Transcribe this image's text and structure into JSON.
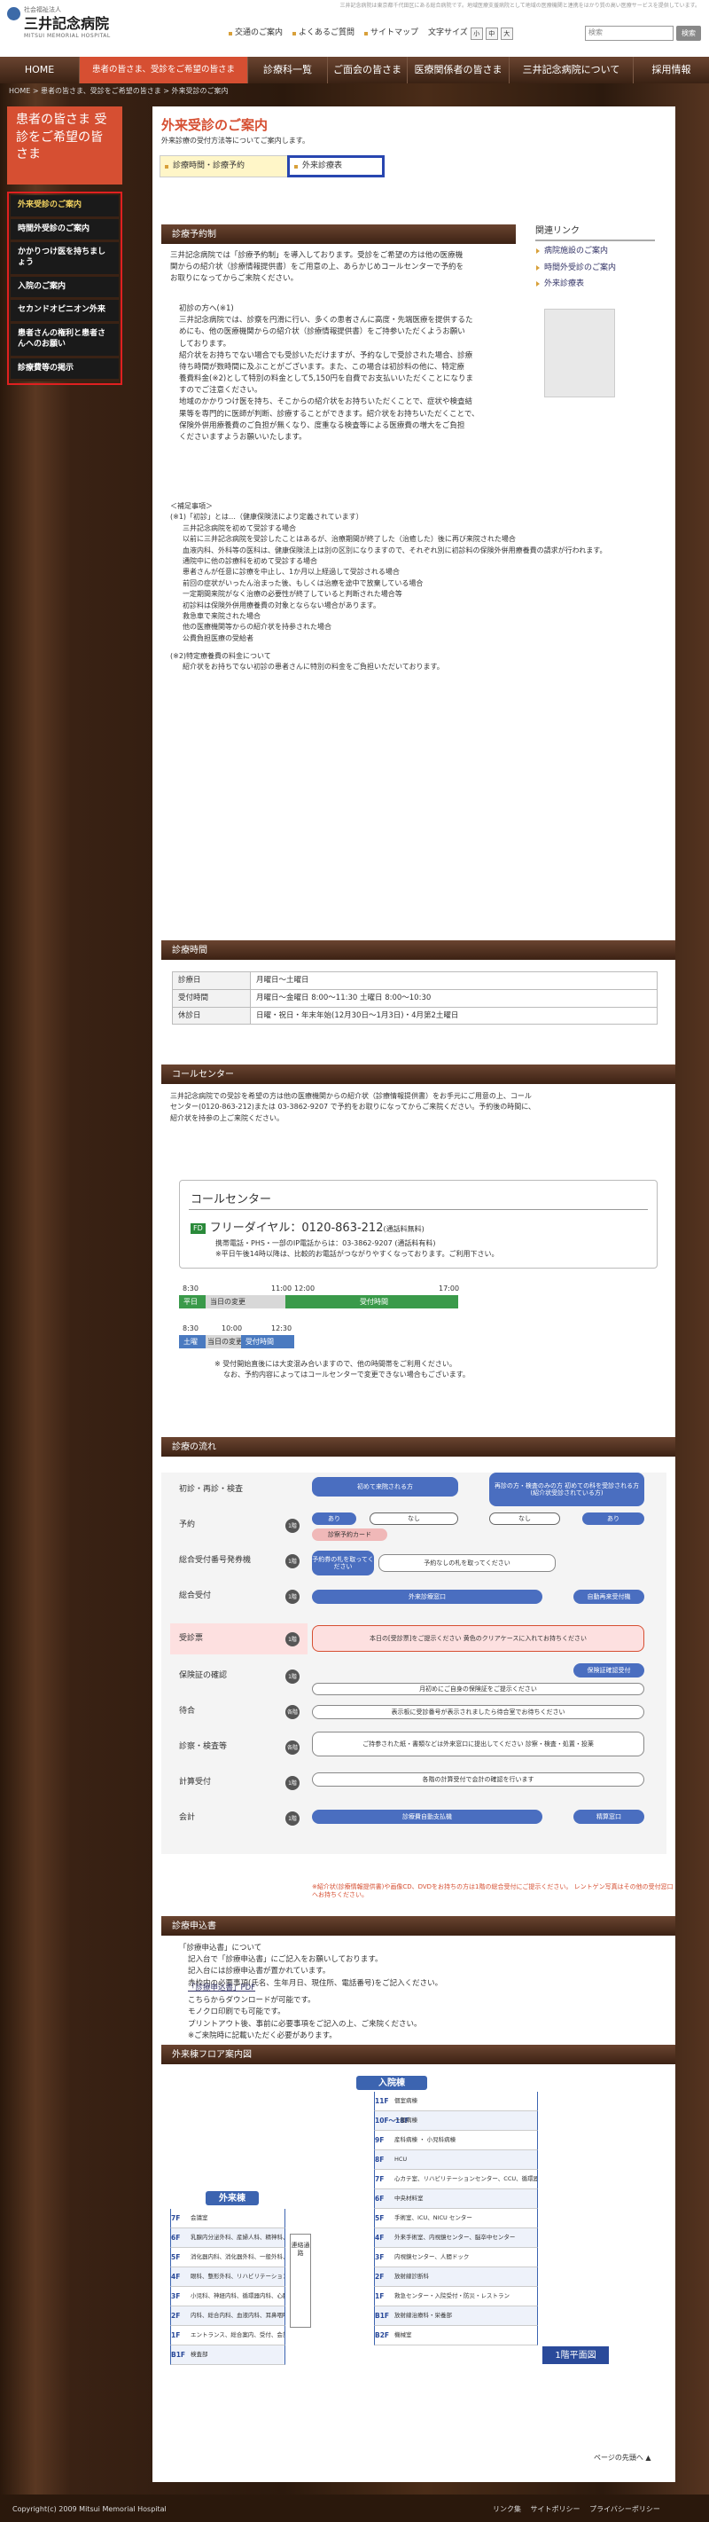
{
  "site": {
    "subtitle": "社会福祉法人",
    "name": "三井記念病院",
    "name_en": "MITSUI MEMORIAL HOSPITAL",
    "tagline": "三井記念病院は東京都千代田区にある総合病院です。地域医療支援病院として地域の医療機関と連携をはかり質の高い医療サービスを提供しています。"
  },
  "util": {
    "links": [
      "交通のご案内",
      "よくあるご質問",
      "サイトマップ"
    ],
    "font_size_label": "文字サイズ",
    "font_sizes": [
      "小",
      "中",
      "大"
    ],
    "search_placeholder": "検索",
    "search_button": "検索"
  },
  "gnav": [
    "HOME",
    "患者の皆さま、受診をご希望の皆さま",
    "診療科一覧",
    "ご面会の皆さま",
    "医療関係者の皆さま",
    "三井記念病院について",
    "採用情報"
  ],
  "breadcrumb": "HOME > 患者の皆さま、受診をご希望の皆さま > 外来受診のご案内",
  "sidebar": {
    "title": "患者の皆さま 受診をご希望の皆さま",
    "items": [
      "外来受診のご案内",
      "時間外受診のご案内",
      "かかりつけ医を持ちましょう",
      "入院のご案内",
      "セカンドオピニオン外来",
      "患者さんの権利と患者さんへのお願い",
      "診療費等の掲示"
    ]
  },
  "page": {
    "title": "外来受診のご案内",
    "lead": "外来診療の受付方法等についてご案内します。",
    "tabs": [
      "診療時間・診療予約",
      "外来診療表"
    ]
  },
  "related": {
    "title": "関連リンク",
    "items": [
      "病院施設のご案内",
      "時間外受診のご案内",
      "外来診療表"
    ]
  },
  "reservation": {
    "heading": "診療予約制",
    "p1": [
      "三井記念病院では「診療予約制」を導入しております。受診をご希望の方は他の医療機",
      "関からの紹介状（診療情報提供書）をご用意の上、あらかじめコールセンターで予約を",
      "お取りになってからご来院ください。"
    ],
    "note_title": "初診の方へ(※1)",
    "note": [
      "三井記念病院では、診察を円滑に行い、多くの患者さんに高度・先端医療を提供するた",
      "めにも、他の医療機関からの紹介状（診療情報提供書）をご持参いただくようお願い",
      "しております。",
      "紹介状をお持ちでない場合でも受診いただけますが、予約なしで受診された場合、診療",
      "待ち時間が数時間に及ぶことがございます。また、この場合は初診料の他に、特定療",
      "養費料金(※2)として特別の料金として5,150円を自費でお支払いいただくことになりま",
      "すのでご注意ください。",
      "地域のかかりつけ医を持ち、そこからの紹介状をお持ちいただくことで、症状や検査結",
      "果等を専門的に医師が判断、診療することができます。紹介状をお持ちいただくことで、",
      "保険外併用療養費のご負担が無くなり、度重なる検査等による医療費の増大をご負担",
      "くださいますようお願いいたします。"
    ],
    "supp_title": "＜補足事項＞",
    "supp": [
      "(※1)「初診」とは…（健康保険法により定義されています）",
      "三井記念病院を初めて受診する場合",
      "以前に三井記念病院を受診したことはあるが、治療期間が終了した（治癒した）後に再び来院された場合",
      "血液内科、外科等の医科は、健康保険法上は別の区別になりますので、それぞれ別に初診料の保険外併用療養費の請求が行われます。",
      "通院中に他の診療科を初めて受診する場合",
      "患者さんが任意に診療を中止し、1か月以上経過して受診される場合",
      "前回の症状がいったん治まった後、もしくは治療を途中で放棄している場合",
      "一定期間来院がなく治療の必要性が終了していると判断された場合等",
      "初診料は保険外併用療養費の対象とならない場合があります。",
      "救急車で来院された場合",
      "他の医療機関等からの紹介状を持参された場合",
      "公費負担医療の受給者",
      "(※2)特定療養費の料金について",
      "紹介状をお持ちでない初診の患者さんに特別の料金をご負担いただいております。"
    ]
  },
  "hours": {
    "heading": "診療時間",
    "rows": [
      {
        "label": "診療日",
        "value": "月曜日～土曜日"
      },
      {
        "label": "受付時間",
        "value": "月曜日～金曜日 8:00～11:30 土曜日 8:00～10:30"
      },
      {
        "label": "休診日",
        "value": "日曜・祝日・年末年始(12月30日～1月3日)・4月第2土曜日"
      }
    ]
  },
  "callcenter": {
    "heading": "コールセンター",
    "p": [
      "三井記念病院での受診を希望の方は他の医療機関からの紹介状（診療情報提供書）をお手元にご用意の上、コール",
      "センター(0120-863-212)または 03-3862-9207 で予約をお取りになってからご来院ください。予約後の時間に、",
      "紹介状を持参の上ご来院ください。"
    ],
    "box_title": "コールセンター",
    "free_label": "フリーダイヤル：0120-863-212",
    "free_note": "(通話料無料)",
    "note1": "携帯電話・PHS・一部のIP電話からは：03-3862-9207 (通話料有料)",
    "note2": "※平日午後14時以降は、比較的お電話がつながりやすくなっております。ご利用下さい。",
    "timeline": {
      "times_weekday": [
        "8:30",
        "11:00",
        "12:00",
        "17:00"
      ],
      "weekday_label": "平日",
      "weekday_seg1": "当日の変更",
      "weekday_seg2": "受付時間",
      "times_sat": [
        "8:30",
        "10:00",
        "12:30"
      ],
      "sat_label": "土曜",
      "sat_seg1": "当日の変更",
      "sat_seg2": "受付時間"
    },
    "notes": [
      "※ 受付開始直後には大変混み合いますので、他の時間帯をご利用ください。",
      "なお、予約内容によってはコールセンターで変更できない場合もございます。"
    ]
  },
  "flow": {
    "heading": "診療の流れ",
    "steps": [
      "初診・再診・検査",
      "予約",
      "総合受付番号発券機",
      "総合受付",
      "受診票",
      "保険証の確認",
      "待合",
      "診察・検査等",
      "計算受付",
      "会計"
    ],
    "nums": [
      "1階",
      "1階",
      "1階",
      "1階",
      "1階",
      "各階",
      "各階",
      "1階",
      "1階"
    ],
    "boxes": {
      "first": "初めて来院される方",
      "return": "再診の方・検査のみの方 初めての科を受診される方 (紹介状受診されている方)",
      "yes": "あり",
      "no": "なし",
      "reserve_card": "診察予約カード",
      "ticket": "予約券の札を取ってください",
      "no_ticket": "予約なしの札を取ってください",
      "reception": "外来診療窓口",
      "machine": "自動再来受付機",
      "form": "本日の[受診票]をご提示ください 黄色のクリアケースに入れてお持ちください",
      "insurance_counter": "保険証確認受付",
      "insurance": "月初めにご自身の保険証をご提示ください",
      "wait": "表示板に受診番号が表示されましたら待合室でお待ちください",
      "exam": "ご持参された紙・書類などは外来窓口に提出してください 診察・検査・処置・投薬",
      "calc": "各階の計算受付で会計の確認を行います",
      "pay": "診療費自動支払機",
      "pay2": "精算窓口"
    },
    "note": "※紹介状(診療情報提供書)や画像CD、DVDをお持ちの方は1階の総合受付にご提示ください。 レントゲン写真はその他の受付窓口へお持ちください。"
  },
  "application": {
    "heading": "診療申込書",
    "items": [
      "「診療申込書」について",
      "記入台で「診療申込書」にご記入をお願いしております。",
      "記入台には診療申込書が置かれています。",
      "赤枠内の必要事項(氏名、生年月日、現住所、電話番号)をご記入ください。",
      "「診療申込書」PDF",
      "こちらからダウンロードが可能です。",
      "モノクロ印刷でも可能です。",
      "プリントアウト後、事前に必要事項をご記入の上、ご来院ください。",
      "※ご来院時に記載いただく必要があります。"
    ]
  },
  "floormap": {
    "heading": "外来棟フロア案内図",
    "inpatient_label": "入院棟",
    "outpatient_label": "外来棟",
    "connector": "連絡通路",
    "inpatient": [
      {
        "f": "11F",
        "t": "個室病棟"
      },
      {
        "f": "10F～18F",
        "t": "一般病棟"
      },
      {
        "f": "9F",
        "t": "産科病棟 ・ 小児科病棟"
      },
      {
        "f": "8F",
        "t": "HCU"
      },
      {
        "f": "7F",
        "t": "心カテ室、リハビリテーションセンター、CCU、循環器病棟"
      },
      {
        "f": "6F",
        "t": "中央材料室"
      },
      {
        "f": "5F",
        "t": "手術室、ICU、NICU センター"
      },
      {
        "f": "4F",
        "t": "外来手術室、内視鏡センター、脳卒中センター"
      },
      {
        "f": "3F",
        "t": "内視鏡センター、人間ドック"
      },
      {
        "f": "2F",
        "t": "放射線診断科"
      },
      {
        "f": "1F",
        "t": "救急センター・入院受付・防災・レストラン"
      },
      {
        "f": "B1F",
        "t": "放射線治療科・栄養部"
      },
      {
        "f": "B2F",
        "t": "機械室"
      }
    ],
    "outpatient": [
      {
        "f": "7F",
        "t": "会議室"
      },
      {
        "f": "6F",
        "t": "乳腺内分泌外科、産婦人科、精神科、歯科・歯科口腔外科、化学療法センター"
      },
      {
        "f": "5F",
        "t": "消化器内科、消化器外科、一般外科、呼吸器内科、呼吸器外科、泌尿器科、皮膚科"
      },
      {
        "f": "4F",
        "t": "眼科、整形外科、リハビリテーション室"
      },
      {
        "f": "3F",
        "t": "小児科、神経内科、循環器内科、心臓血管外科、腎臓内科、糖尿病"
      },
      {
        "f": "2F",
        "t": "内科、総合内科、血液内科、耳鼻咽喉科、形成外科"
      },
      {
        "f": "1F",
        "t": "エントランス、総合案内、受付、会計、薬局、救急センター"
      },
      {
        "f": "B1F",
        "t": "検査部"
      }
    ],
    "plan_button": "1階平面図"
  },
  "pagetop": "ページの先頭へ ▲",
  "footer": {
    "copyright": "Copyright(c) 2009 Mitsui Memorial Hospital",
    "links": [
      "リンク集",
      "サイトポリシー",
      "プライバシーポリシー"
    ]
  }
}
